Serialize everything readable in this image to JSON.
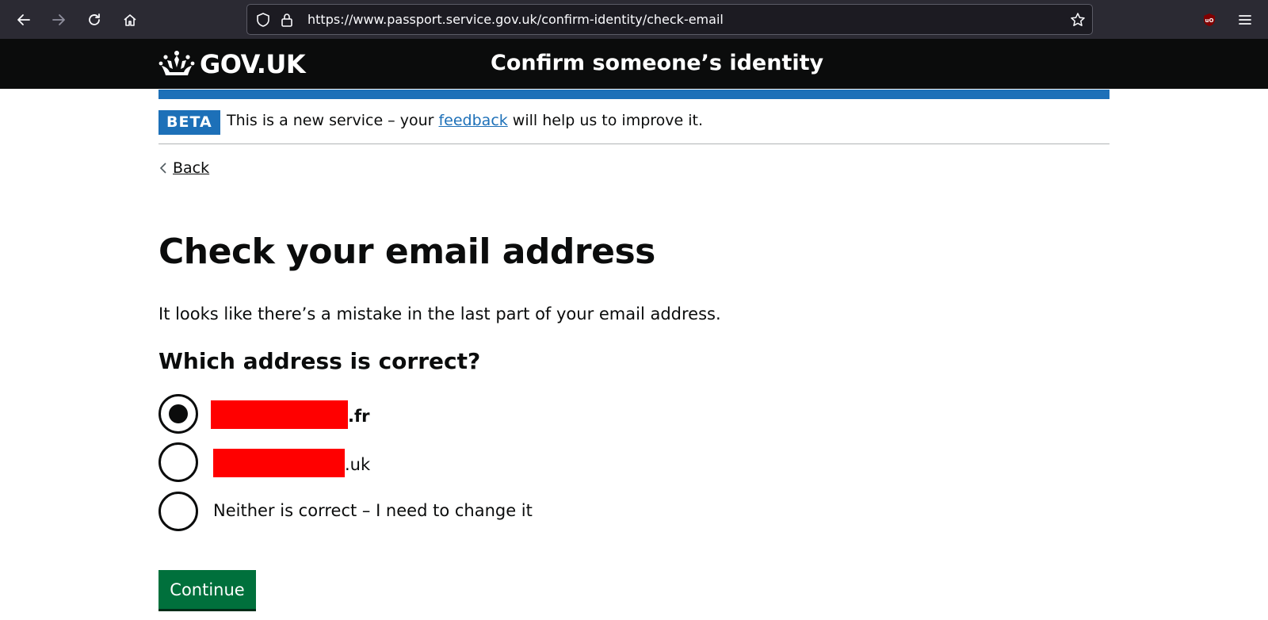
{
  "browser": {
    "url": "https://www.passport.service.gov.uk/confirm-identity/check-email"
  },
  "header": {
    "logotype": "GOV.UK",
    "service_name": "Confirm someone’s identity"
  },
  "phase_banner": {
    "tag": "BETA",
    "text_before": "This is a new service – your ",
    "link_text": "feedback",
    "text_after": " will help us to improve it."
  },
  "back_link": "Back",
  "main": {
    "title": "Check your email address",
    "body": "It looks like there’s a mistake in the last part of your email address.",
    "legend": "Which address is correct?",
    "options": [
      {
        "suffix": ".fr",
        "checked": true
      },
      {
        "suffix": ".uk",
        "checked": false
      },
      {
        "label": "Neither is correct – I need to change it",
        "checked": false
      }
    ],
    "continue_label": "Continue"
  },
  "colors": {
    "header_bg": "#0b0c0c",
    "brand_blue": "#1d70b8",
    "button_green": "#00703c",
    "redaction": "#ff0000"
  }
}
